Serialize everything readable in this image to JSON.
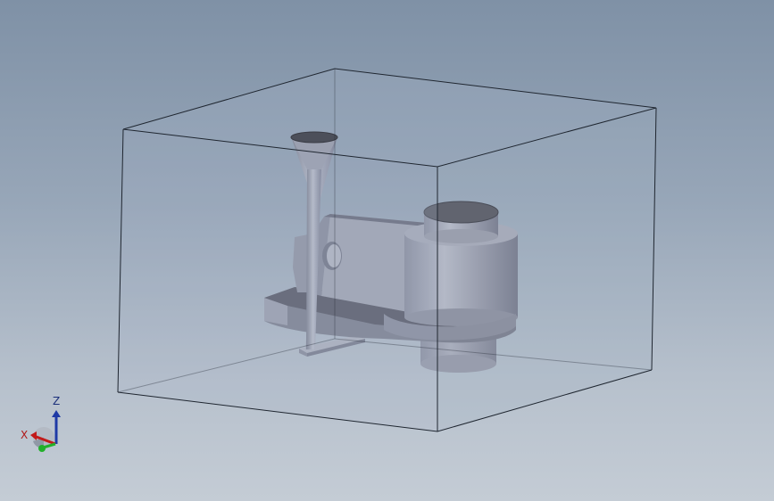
{
  "viewport": {
    "background_top": "#7f91a6",
    "background_bottom": "#c4ccd5"
  },
  "model": {
    "bounding_box_color": "#1f2630",
    "part_color": "#a2a7b5",
    "part_shadow_color": "#5e6170",
    "box_fill_color": "#a7b5c9"
  },
  "triad": {
    "z_label": "Z",
    "x_label": "X",
    "z_color": "#1f3aa6",
    "x_color": "#c21a1a",
    "y_color": "#22b02a"
  }
}
